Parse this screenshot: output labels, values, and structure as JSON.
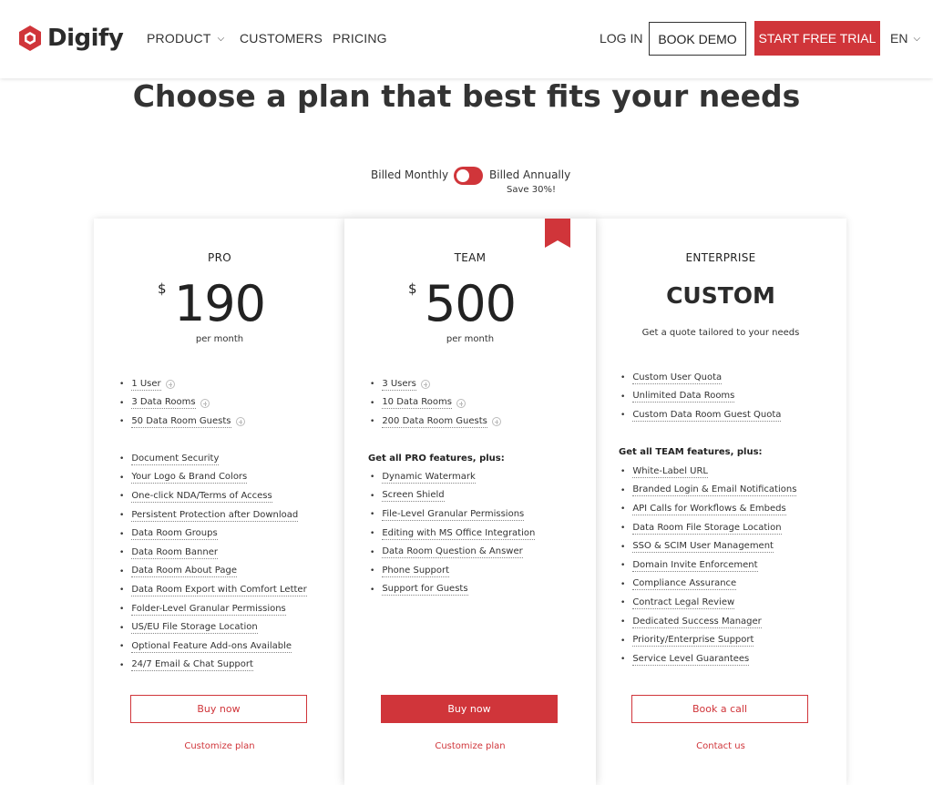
{
  "header": {
    "logo_text": "Digify",
    "nav": [
      {
        "label": "PRODUCT",
        "has_dropdown": true
      },
      {
        "label": "CUSTOMERS",
        "has_dropdown": false
      },
      {
        "label": "PRICING",
        "has_dropdown": false
      }
    ],
    "login_label": "LOG IN",
    "demo_label": "BOOK DEMO",
    "trial_label": "START FREE TRIAL",
    "lang_label": "EN"
  },
  "page_title": "Choose a plan that best fits your needs",
  "billing": {
    "monthly_label": "Billed Monthly",
    "annual_label": "Billed Annually",
    "save_note": "Save 30%!",
    "annual_selected": true
  },
  "plans": {
    "pro": {
      "name": "PRO",
      "currency": "$",
      "price": "190",
      "period": "per month",
      "quota": [
        "1 User",
        "3 Data Rooms",
        "50 Data Room Guests"
      ],
      "features": [
        "Document Security",
        "Your Logo & Brand Colors",
        "One-click NDA/Terms of Access",
        "Persistent Protection after Download",
        "Data Room Groups",
        "Data Room Banner",
        "Data Room About Page",
        "Data Room Export with Comfort Letter",
        "Folder-Level Granular Permissions",
        "US/EU File Storage Location",
        "Optional Feature Add-ons Available",
        "24/7 Email & Chat Support"
      ],
      "button_label": "Buy now",
      "link_label": "Customize plan"
    },
    "team": {
      "name": "TEAM",
      "currency": "$",
      "price": "500",
      "period": "per month",
      "quota": [
        "3 Users",
        "10 Data Rooms",
        "200 Data Room Guests"
      ],
      "features_heading": "Get all PRO features, plus:",
      "features": [
        "Dynamic Watermark",
        "Screen Shield",
        "File-Level Granular Permissions",
        "Editing with MS Office Integration",
        "Data Room Question & Answer",
        "Phone Support",
        "Support for Guests"
      ],
      "button_label": "Buy now",
      "link_label": "Customize plan"
    },
    "enterprise": {
      "name": "ENTERPRISE",
      "price_text": "CUSTOM",
      "tagline": "Get a quote tailored to your needs",
      "quota": [
        "Custom User Quota",
        "Unlimited Data Rooms",
        "Custom Data Room Guest Quota"
      ],
      "features_heading": "Get all TEAM features, plus:",
      "features": [
        "White-Label URL",
        "Branded Login & Email Notifications",
        "API Calls for Workflows & Embeds",
        "Data Room File Storage Location",
        "SSO & SCIM User Management",
        "Domain Invite Enforcement",
        "Compliance Assurance",
        "Contract Legal Review",
        "Dedicated Success Manager",
        "Priority/Enterprise Support",
        "Service Level Guarantees"
      ],
      "button_label": "Book a call",
      "link_label": "Contact us"
    }
  },
  "colors": {
    "accent": "#d0353a",
    "text": "#222222"
  }
}
